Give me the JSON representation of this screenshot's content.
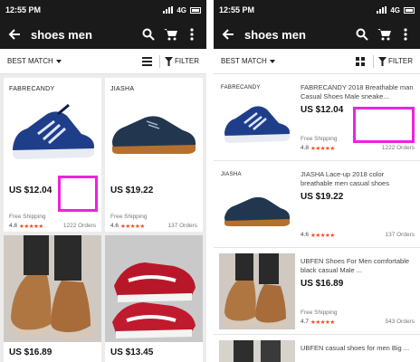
{
  "colors": {
    "appbar": "#1a1a1a",
    "accent_star": "#f44a1f",
    "highlight": "#ee22dd"
  },
  "left": {
    "status": {
      "time": "12:55 PM",
      "network": "4G"
    },
    "appbar": {
      "query": "shoes men",
      "icons": [
        "back-arrow-icon",
        "search-icon",
        "cart-icon",
        "more-vert-icon"
      ]
    },
    "sortbar": {
      "sort_label": "BEST MATCH",
      "filter_label": "FILTER",
      "layout_icon": "list-view-icon"
    },
    "products": [
      {
        "brand": "FABRECANDY",
        "price": "US $12.04",
        "shipping": "Free Shipping",
        "rating": "4.8",
        "stars": "★★★★★",
        "orders": "1222 Orders"
      },
      {
        "brand": "JIASHA",
        "price": "US $19.22",
        "shipping": "Free Shipping",
        "rating": "4.6",
        "stars": "★★★★★",
        "orders": "137 Orders"
      },
      {
        "price": "US $16.89"
      },
      {
        "price": "US $13.45"
      }
    ]
  },
  "right": {
    "status": {
      "time": "12:55 PM",
      "network": "4G"
    },
    "appbar": {
      "query": "shoes men",
      "icons": [
        "back-arrow-icon",
        "search-icon",
        "cart-icon",
        "more-vert-icon"
      ]
    },
    "sortbar": {
      "sort_label": "BEST MATCH",
      "filter_label": "FILTER",
      "layout_icon": "grid-view-icon"
    },
    "products": [
      {
        "brand": "FABRECANDY",
        "title": "FABRECANDY 2018 Breathable man Casual Shoes Male sneake...",
        "price": "US $12.04",
        "shipping": "Free Shipping",
        "rating": "4.8",
        "stars": "★★★★★",
        "orders": "1222 Orders"
      },
      {
        "brand": "JIASHA",
        "title": "JIASHA Lace-up 2018 color breathable men casual shoes",
        "price": "US $19.22",
        "shipping": "",
        "rating": "4.6",
        "stars": "★★★★★",
        "orders": "137 Orders"
      },
      {
        "title": "UBFEN Shoes For Men comfortable black casual Male ...",
        "price": "US $16.89",
        "shipping": "Free Shipping",
        "rating": "4.7",
        "stars": "★★★★★",
        "orders": "543 Orders"
      },
      {
        "title": "UBFEN casual shoes for men Big ..."
      }
    ]
  }
}
